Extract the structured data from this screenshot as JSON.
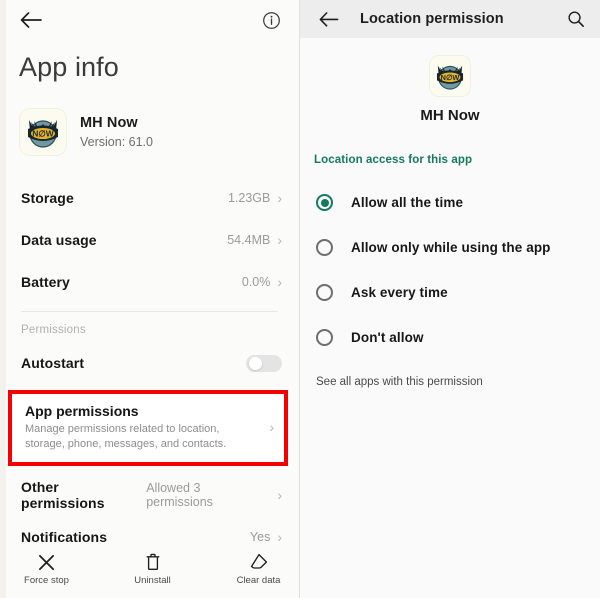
{
  "left_panel": {
    "topbar": {
      "back_icon": "back-arrow-icon",
      "info_icon": "info-circle-icon"
    },
    "page_title": "App info",
    "app": {
      "name": "MH Now",
      "version": "Version: 61.0",
      "icon": "mh-now-app-icon"
    },
    "rows": [
      {
        "label": "Storage",
        "value": "1.23GB",
        "chevron": "›"
      },
      {
        "label": "Data usage",
        "value": "54.4MB",
        "chevron": "›"
      },
      {
        "label": "Battery",
        "value": "0.0%",
        "chevron": "›"
      }
    ],
    "section_label": "Permissions",
    "autostart": {
      "label": "Autostart",
      "toggle_state": "off"
    },
    "app_permissions": {
      "title": "App permissions",
      "subtitle": "Manage permissions related to location, storage, phone, messages, and contacts.",
      "chevron": "›",
      "highlight_color": "#f50000"
    },
    "bottom_rows": [
      {
        "label": "Other permissions",
        "value": "Allowed 3 permissions",
        "chevron": "›"
      },
      {
        "label": "Notifications",
        "value": "Yes",
        "chevron": "›"
      }
    ],
    "actions": [
      {
        "label": "Force stop",
        "icon": "close-x-icon"
      },
      {
        "label": "Uninstall",
        "icon": "trash-can-icon"
      },
      {
        "label": "Clear data",
        "icon": "eraser-icon"
      }
    ]
  },
  "right_panel": {
    "topbar": {
      "back_icon": "back-arrow-icon",
      "title": "Location permission",
      "search_icon": "search-icon"
    },
    "app": {
      "name": "MH Now",
      "icon": "mh-now-app-icon"
    },
    "access_label": "Location access for this app",
    "accent_color": "#16795e",
    "options": [
      {
        "label": "Allow all the time",
        "selected": true
      },
      {
        "label": "Allow only while using the app",
        "selected": false
      },
      {
        "label": "Ask every time",
        "selected": false
      },
      {
        "label": "Don't allow",
        "selected": false
      }
    ],
    "see_all_link": "See all apps with this permission"
  }
}
